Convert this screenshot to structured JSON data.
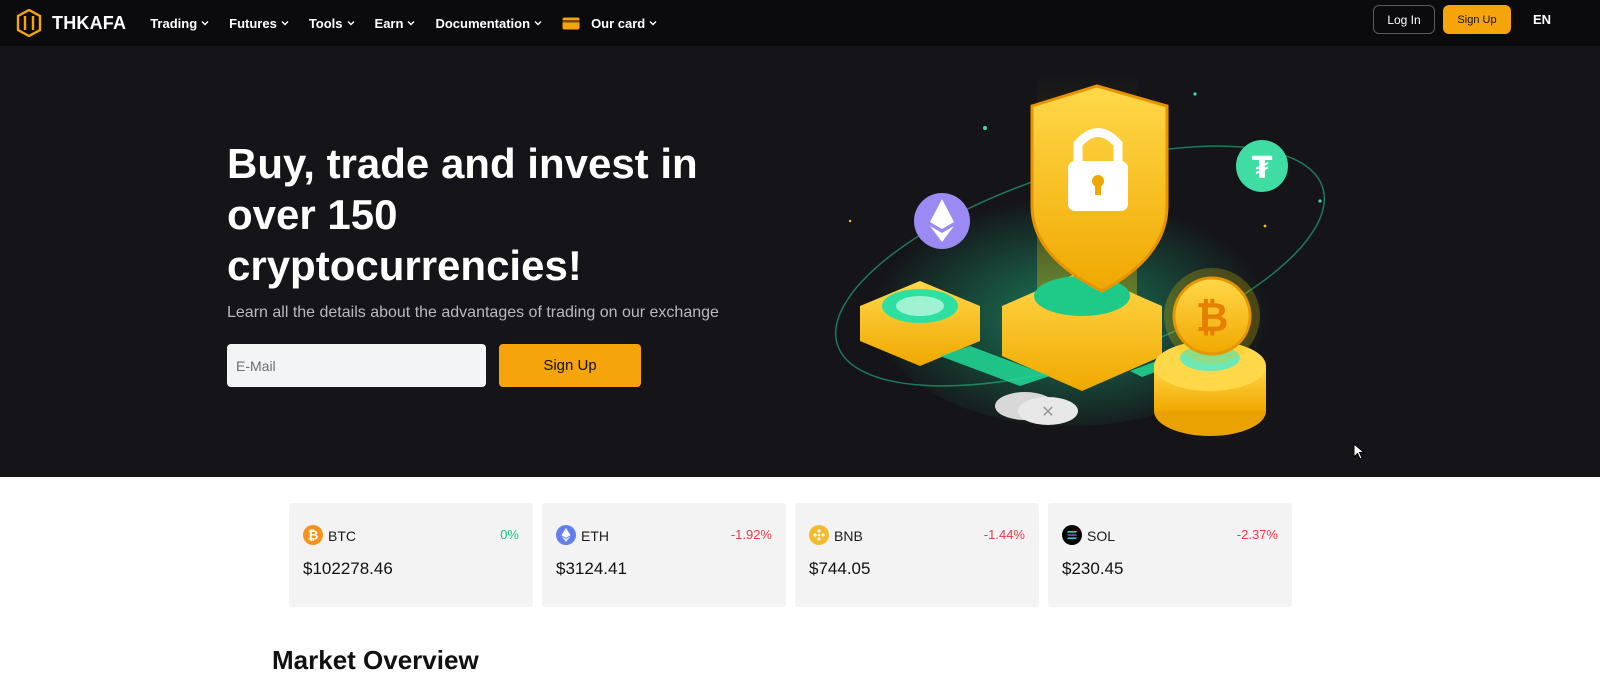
{
  "brand": {
    "name": "THKAFA",
    "accent": "#f5a40b"
  },
  "nav": {
    "items": [
      {
        "label": "Trading",
        "name": "nav-trading"
      },
      {
        "label": "Futures",
        "name": "nav-futures"
      },
      {
        "label": "Tools",
        "name": "nav-tools"
      },
      {
        "label": "Earn",
        "name": "nav-earn"
      },
      {
        "label": "Documentation",
        "name": "nav-documentation"
      },
      {
        "label": "Our card",
        "name": "nav-our-card"
      }
    ],
    "login_label": "Log In",
    "signup_label": "Sign Up",
    "language": "EN"
  },
  "hero": {
    "title": "Buy, trade and invest in over 150 cryptocurrencies!",
    "subtitle": "Learn all the details about the advantages of trading on our exchange",
    "email_placeholder": "E-Mail",
    "signup_label": "Sign Up"
  },
  "tickers": [
    {
      "symbol": "BTC",
      "change": "0%",
      "price": "$102278.46",
      "change_color": "#16c784",
      "icon": "bitcoin-icon",
      "icon_color": "#f7931a"
    },
    {
      "symbol": "ETH",
      "change": "-1.92%",
      "price": "$3124.41",
      "change_color": "#ea3943",
      "icon": "ethereum-icon",
      "icon_color": "#627eea"
    },
    {
      "symbol": "BNB",
      "change": "-1.44%",
      "price": "$744.05",
      "change_color": "#ea3943",
      "icon": "bnb-icon",
      "icon_color": "#f3ba2f"
    },
    {
      "symbol": "SOL",
      "change": "-2.37%",
      "price": "$230.45",
      "change_color": "#ea3943",
      "icon": "solana-icon",
      "icon_color": "#000000"
    }
  ],
  "market": {
    "title": "Market Overview"
  }
}
